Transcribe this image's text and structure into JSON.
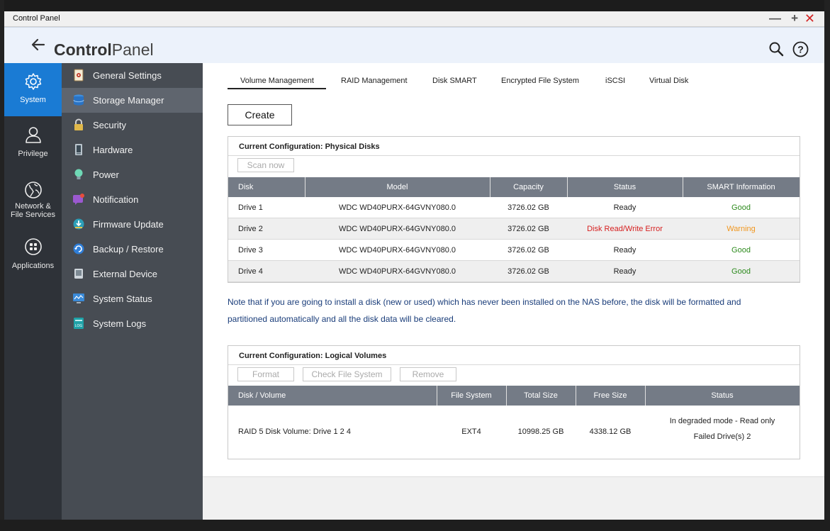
{
  "window": {
    "title": "Control Panel",
    "minimize_label": "—",
    "maximize_label": "+",
    "close_label": "✕"
  },
  "header": {
    "brand_bold": "Control",
    "brand_light": "Panel"
  },
  "leftnav": [
    {
      "label": "System",
      "icon": "gear-icon",
      "active": true
    },
    {
      "label": "Privilege",
      "icon": "user-icon",
      "active": false
    },
    {
      "label_line1": "Network &",
      "label_line2": "File Services",
      "icon": "globe-icon",
      "active": false
    },
    {
      "label": "Applications",
      "icon": "apps-grid-icon",
      "active": false
    }
  ],
  "subnav": [
    {
      "label": "General Settings",
      "icon": "settings-doc-icon"
    },
    {
      "label": "Storage Manager",
      "icon": "database-icon",
      "active": true
    },
    {
      "label": "Security",
      "icon": "lock-icon"
    },
    {
      "label": "Hardware",
      "icon": "hardware-icon"
    },
    {
      "label": "Power",
      "icon": "bulb-icon"
    },
    {
      "label": "Notification",
      "icon": "notification-icon"
    },
    {
      "label": "Firmware Update",
      "icon": "firmware-icon"
    },
    {
      "label": "Backup / Restore",
      "icon": "backup-icon"
    },
    {
      "label": "External Device",
      "icon": "external-device-icon"
    },
    {
      "label": "System Status",
      "icon": "monitor-icon"
    },
    {
      "label": "System Logs",
      "icon": "logs-icon"
    }
  ],
  "tabs": [
    {
      "label": "Volume Management",
      "active": true
    },
    {
      "label": "RAID Management"
    },
    {
      "label": "Disk SMART"
    },
    {
      "label": "Encrypted File System"
    },
    {
      "label": "iSCSI"
    },
    {
      "label": "Virtual Disk"
    }
  ],
  "create_label": "Create",
  "physical": {
    "title": "Current Configuration: Physical Disks",
    "scan_label": "Scan now",
    "headers": [
      "Disk",
      "Model",
      "Capacity",
      "Status",
      "SMART Information"
    ],
    "rows": [
      {
        "disk": "Drive 1",
        "model": "WDC WD40PURX-64GVNY080.0",
        "capacity": "3726.02 GB",
        "status": "Ready",
        "smart": "Good"
      },
      {
        "disk": "Drive 2",
        "model": "WDC WD40PURX-64GVNY080.0",
        "capacity": "3726.02 GB",
        "status": "Disk Read/Write Error",
        "smart": "Warning"
      },
      {
        "disk": "Drive 3",
        "model": "WDC WD40PURX-64GVNY080.0",
        "capacity": "3726.02 GB",
        "status": "Ready",
        "smart": "Good"
      },
      {
        "disk": "Drive 4",
        "model": "WDC WD40PURX-64GVNY080.0",
        "capacity": "3726.02 GB",
        "status": "Ready",
        "smart": "Good"
      }
    ]
  },
  "note": {
    "line1": "Note that if you are going to install a disk (new or used) which has never been installed on the NAS before, the disk will be formatted and",
    "line2": "partitioned automatically and all the disk data will be cleared."
  },
  "logical": {
    "title": "Current Configuration: Logical Volumes",
    "format_label": "Format",
    "check_label": "Check File System",
    "remove_label": "Remove",
    "headers": [
      "Disk / Volume",
      "File System",
      "Total Size",
      "Free Size",
      "Status"
    ],
    "row": {
      "volume": "RAID 5 Disk Volume: Drive 1 2 4",
      "fs": "EXT4",
      "total": "10998.25 GB",
      "free": "4338.12 GB",
      "status_line1": "In degraded mode - Read only",
      "status_line2": "Failed Drive(s) 2"
    }
  },
  "colors": {
    "accent": "#1a7bd4",
    "good": "#2e8b1e",
    "warning": "#f0961e",
    "error": "#d62020",
    "note": "#1a3d7a"
  }
}
